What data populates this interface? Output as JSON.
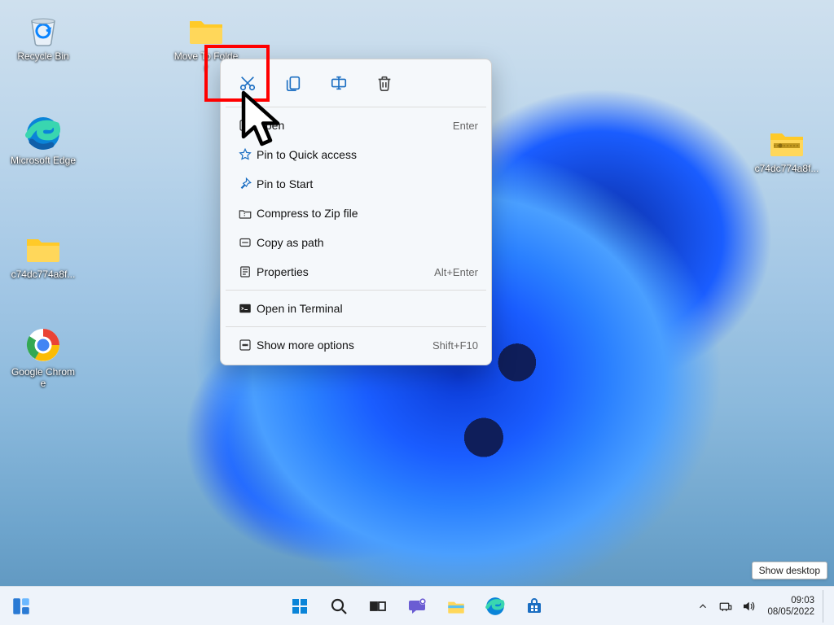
{
  "desktop_icons": {
    "recycle_bin": "Recycle Bin",
    "move_to_folder": "Move To Folder",
    "edge": "Microsoft Edge",
    "folder_left": "c74dc774a8f...",
    "chrome": "Google Chrome",
    "zip_right": "c74dc774a8f..."
  },
  "context_menu": {
    "open": "Open",
    "open_shortcut": "Enter",
    "pin_quick": "Pin to Quick access",
    "pin_start": "Pin to Start",
    "compress": "Compress to Zip file",
    "copy_path": "Copy as path",
    "properties": "Properties",
    "properties_shortcut": "Alt+Enter",
    "open_terminal": "Open in Terminal",
    "show_more": "Show more options",
    "show_more_shortcut": "Shift+F10"
  },
  "tooltip": {
    "show_desktop": "Show desktop"
  },
  "clock": {
    "time": "09:03",
    "date": "08/05/2022"
  }
}
